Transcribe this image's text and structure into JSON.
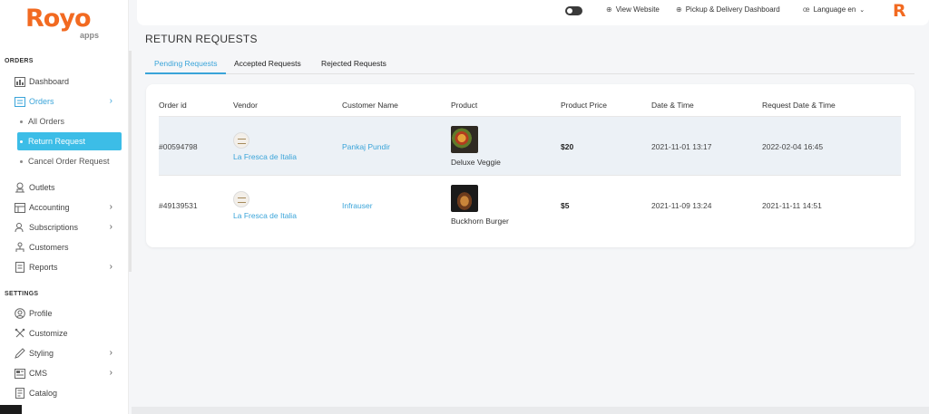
{
  "logo": {
    "name": "Royo",
    "sub": "apps"
  },
  "sidebar": {
    "orders_title": "ORDERS",
    "settings_title": "SETTINGS",
    "items": {
      "dashboard": "Dashboard",
      "orders": "Orders",
      "all_orders": "All Orders",
      "return_request": "Return Request",
      "cancel_order_request": "Cancel Order Request",
      "outlets": "Outlets",
      "accounting": "Accounting",
      "subscriptions": "Subscriptions",
      "customers": "Customers",
      "reports": "Reports",
      "profile": "Profile",
      "customize": "Customize",
      "styling": "Styling",
      "cms": "CMS",
      "catalog": "Catalog"
    }
  },
  "header": {
    "view_website": "View Website",
    "pickup_delivery": "Pickup & Delivery Dashboard",
    "language": "Language en",
    "brand_letter": "R"
  },
  "page": {
    "title": "RETURN REQUESTS",
    "tabs": [
      "Pending Requests",
      "Accepted Requests",
      "Rejected Requests"
    ],
    "active_tab": "Pending Requests"
  },
  "table": {
    "columns": [
      "Order id",
      "Vendor",
      "Customer Name",
      "Product",
      "Product Price",
      "Date & Time",
      "Request Date & Time"
    ],
    "rows": [
      {
        "order_id": "#00594798",
        "vendor": "La Fresca de Italia",
        "customer": "Pankaj Pundir",
        "product": "Deluxe Veggie",
        "price": "$20",
        "date": "2021-11-01 13:17",
        "request_date": "2022-02-04 16:45"
      },
      {
        "order_id": "#49139531",
        "vendor": "La Fresca de Italia",
        "customer": "Infrauser",
        "product": "Buckhorn Burger",
        "price": "$5",
        "date": "2021-11-09 13:24",
        "request_date": "2021-11-11 14:51"
      }
    ]
  },
  "colors": {
    "accent": "#3aa4d9",
    "active_bg": "#3cbde7",
    "brand": "#f26a21"
  }
}
